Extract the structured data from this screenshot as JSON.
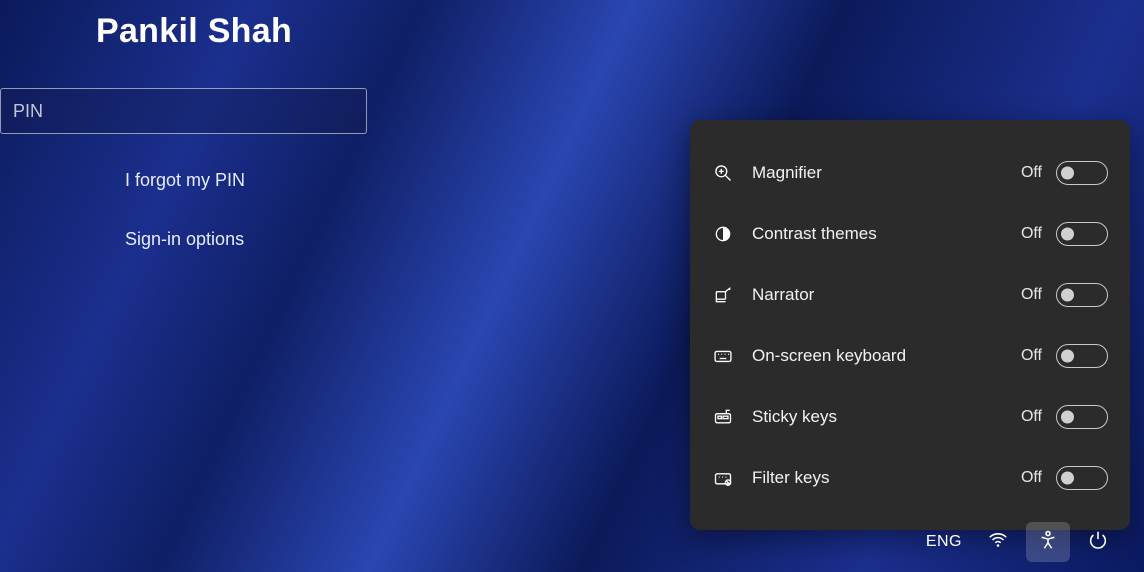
{
  "user": {
    "name": "Pankil Shah"
  },
  "pin": {
    "placeholder": "PIN",
    "value": ""
  },
  "links": {
    "forgot": "I forgot my PIN",
    "options": "Sign-in options"
  },
  "a11y": {
    "items": [
      {
        "label": "Magnifier",
        "state": "Off"
      },
      {
        "label": "Contrast themes",
        "state": "Off"
      },
      {
        "label": "Narrator",
        "state": "Off"
      },
      {
        "label": "On-screen keyboard",
        "state": "Off"
      },
      {
        "label": "Sticky keys",
        "state": "Off"
      },
      {
        "label": "Filter keys",
        "state": "Off"
      }
    ]
  },
  "tray": {
    "lang": "ENG"
  }
}
